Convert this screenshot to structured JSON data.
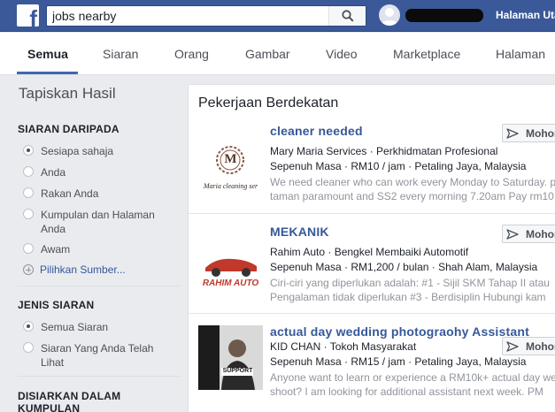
{
  "header": {
    "search_value": "jobs nearby",
    "home_label": "Halaman Uta"
  },
  "tabs": [
    {
      "label": "Semua"
    },
    {
      "label": "Siaran"
    },
    {
      "label": "Orang"
    },
    {
      "label": "Gambar"
    },
    {
      "label": "Video"
    },
    {
      "label": "Marketplace"
    },
    {
      "label": "Halaman"
    }
  ],
  "filters": {
    "title": "Tapiskan Hasil",
    "post_source": {
      "title": "SIARAN DARIPADA",
      "options": [
        "Sesiapa sahaja",
        "Anda",
        "Rakan Anda",
        "Kumpulan dan Halaman Anda",
        "Awam"
      ],
      "selected": "Sesiapa sahaja",
      "more_label": "Pilihkan Sumber..."
    },
    "post_type": {
      "title": "JENIS SIARAN",
      "options": [
        "Semua Siaran",
        "Siaran Yang Anda Telah Lihat"
      ],
      "selected": "Semua Siaran"
    },
    "posted_in_group": {
      "title": "DISIARKAN DALAM KUMPULAN"
    }
  },
  "results": {
    "title": "Pekerjaan Berdekatan",
    "apply_label": "Mohon",
    "jobs": [
      {
        "title": "cleaner needed",
        "employer_line": "Mary Maria Services · Perkhidmatan Profesional",
        "details_line": "Sepenuh Masa · RM10 / jam · Petaling Jaya, Malaysia",
        "desc_line1": "We need cleaner who can work every Monday to Saturday. p",
        "desc_line2": "taman paramount and SS2 every morning 7.20am Pay rm10",
        "logo_letter": "M",
        "logo_caption": "Maria cleaning ser"
      },
      {
        "title": "MEKANIK",
        "employer_line": "Rahim Auto · Bengkel Membaiki Automotif",
        "details_line": "Sepenuh Masa · RM1,200 / bulan · Shah Alam, Malaysia",
        "desc_line1": "Ciri-ciri yang diperlukan adalah: #1 - Sijil SKM Tahap II atau",
        "desc_line2": "Pengalaman tidak diperlukan #3 - Berdisiplin Hubungi kam",
        "logo_text": "RAHIM AUTO"
      },
      {
        "title": "actual day wedding photograohy Assistant",
        "employer_line": "KID CHAN · Tokoh Masyarakat",
        "details_line": "Sepenuh Masa · RM15 / jam · Petaling Jaya, Malaysia",
        "desc_line1": "Anyone want to learn or experience a RM10k+ actual day we",
        "desc_line2": "shoot? I am looking for additional assistant next week. PM",
        "logo_text": "SUPPORT"
      }
    ]
  }
}
